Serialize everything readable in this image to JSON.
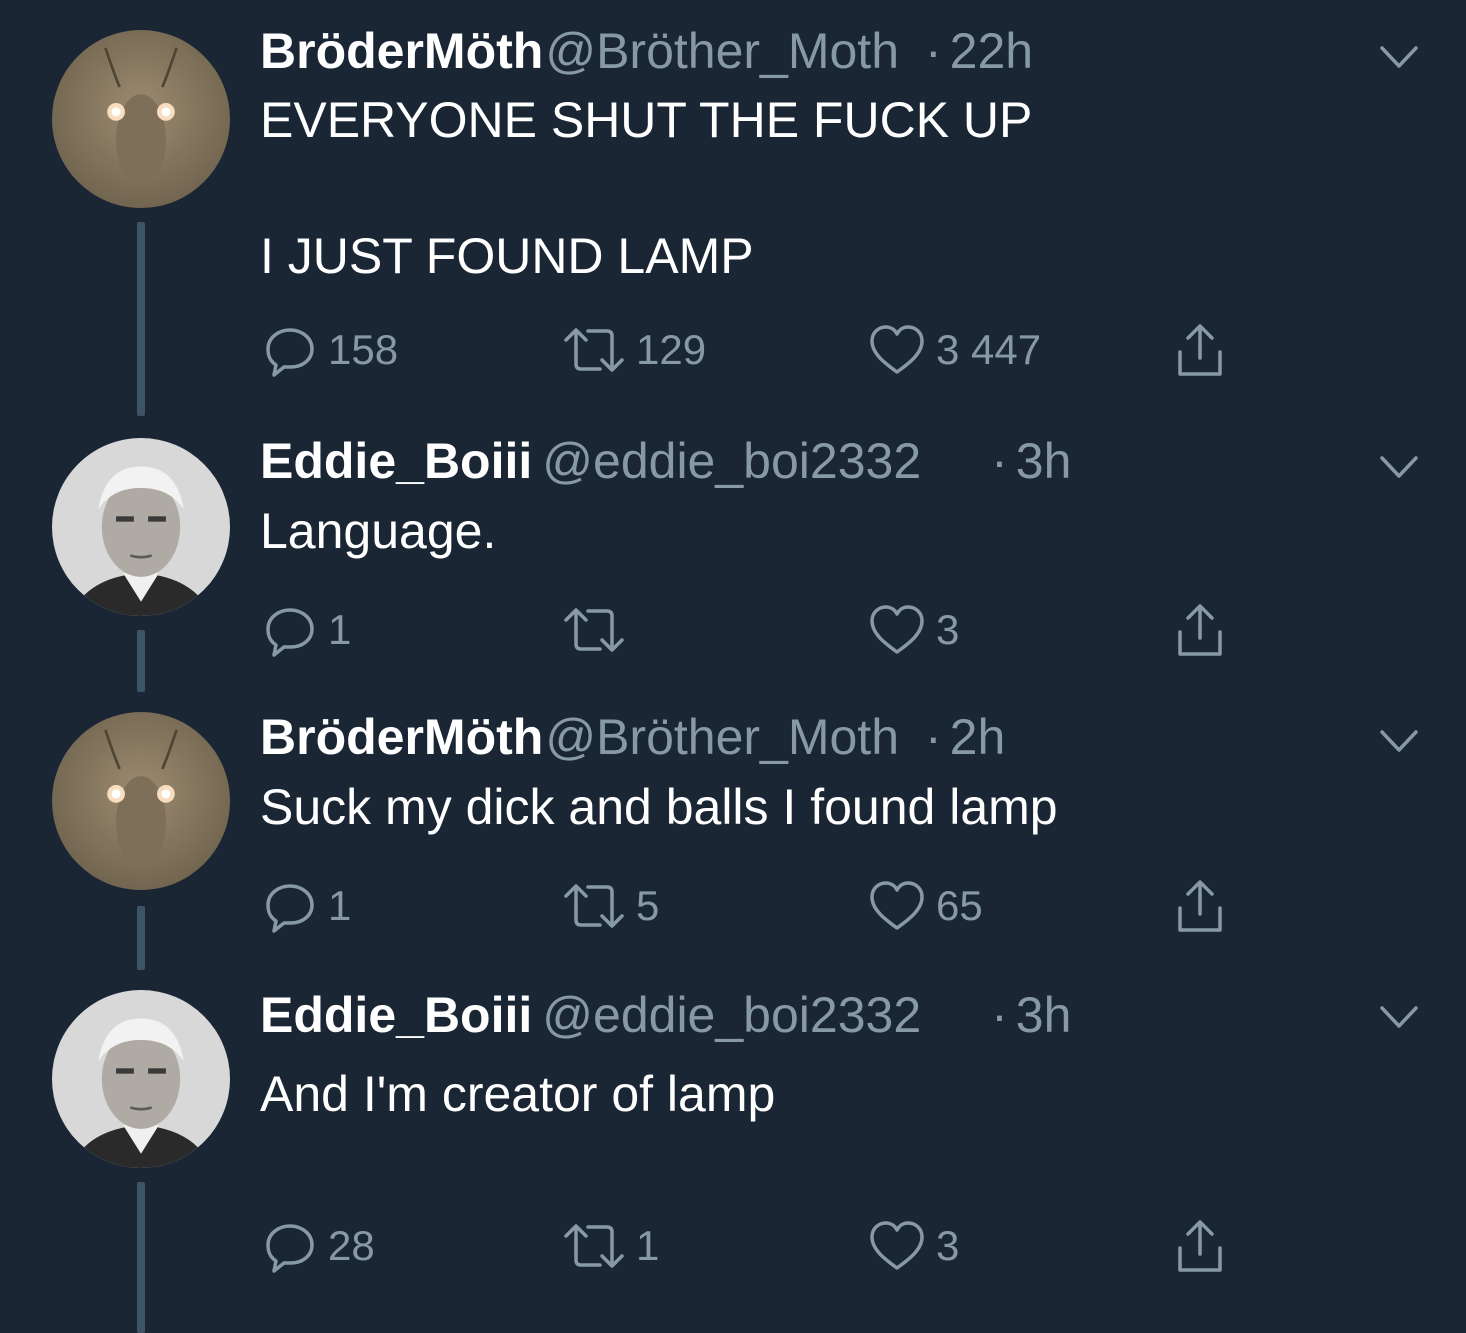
{
  "colors": {
    "background": "#1b2634",
    "secondary": "#8899a6",
    "thread_line": "#3d5466"
  },
  "tweets": [
    {
      "name": "BröderMöth",
      "handle": "@Bröther_Moth",
      "dot": "·",
      "time": "22h",
      "text": "EVERYONE SHUT THE FUCK UP\n\nI JUST FOUND LAMP",
      "avatar": "moth-avatar",
      "replies": "158",
      "retweets": "129",
      "likes": "3 447"
    },
    {
      "name": "Eddie_Boiii",
      "handle": "@eddie_boi2332",
      "dot": "·",
      "time": "3h",
      "text": "Language.",
      "avatar": "edison-avatar",
      "replies": "1",
      "retweets": "",
      "likes": "3"
    },
    {
      "name": "BröderMöth",
      "handle": "@Bröther_Moth",
      "dot": "·",
      "time": "2h",
      "text": "Suck my dick and balls I found lamp",
      "avatar": "moth-avatar",
      "replies": "1",
      "retweets": "5",
      "likes": "65"
    },
    {
      "name": "Eddie_Boiii",
      "handle": "@eddie_boi2332",
      "dot": "·",
      "time": "3h",
      "text": "And I'm creator of lamp",
      "avatar": "edison-avatar",
      "replies": "28",
      "retweets": "1",
      "likes": "3"
    }
  ]
}
